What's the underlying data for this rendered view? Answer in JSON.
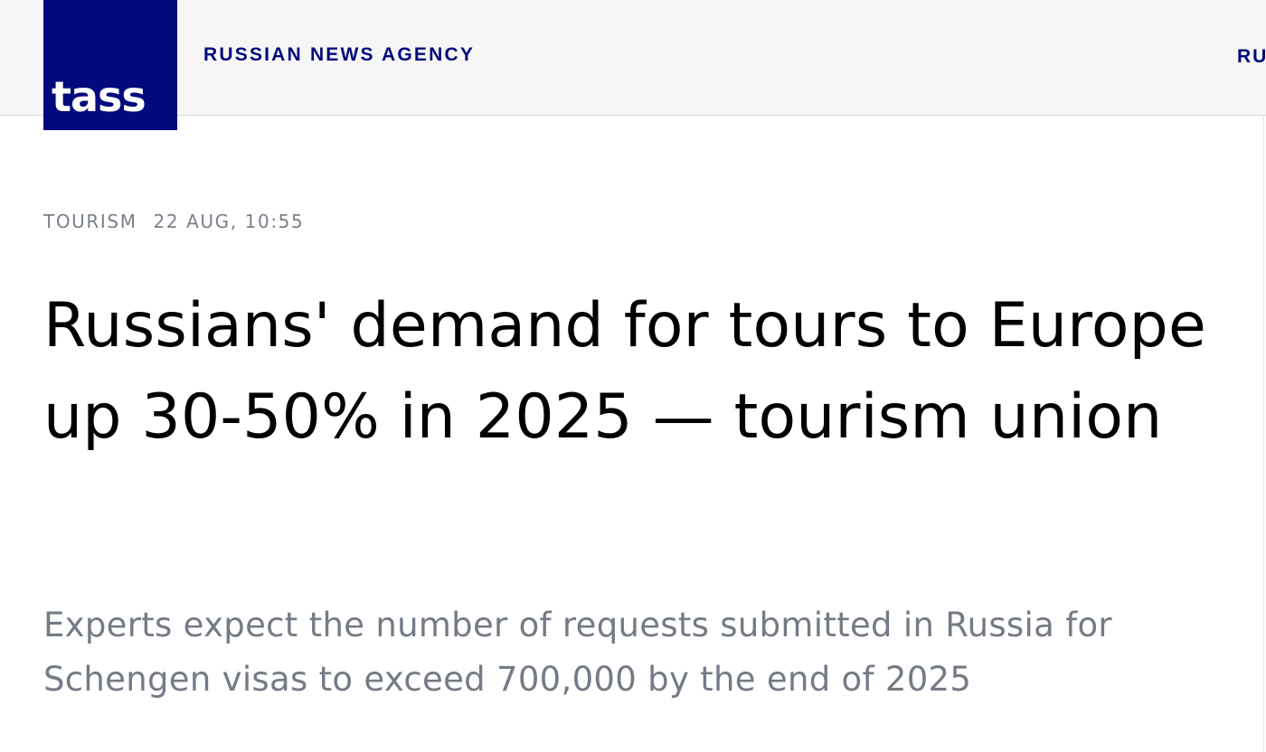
{
  "header": {
    "logo_text": "tass",
    "agency_name": "RUSSIAN NEWS AGENCY",
    "language_switch": "RU"
  },
  "article": {
    "rubric": "TOURISM",
    "date": "22 AUG, 10:55",
    "headline": "Russians' demand for tours to Europe up 30-50% in 2025 — tourism union",
    "lead": "Experts expect the number of requests submitted in Russia for Schengen visas to exceed 700,000 by the end of 2025"
  },
  "colors": {
    "brand": "#000a7c",
    "topbar_bg": "#f6f6f6",
    "meta_text": "#7a7f89",
    "lead_text": "#747b85"
  }
}
